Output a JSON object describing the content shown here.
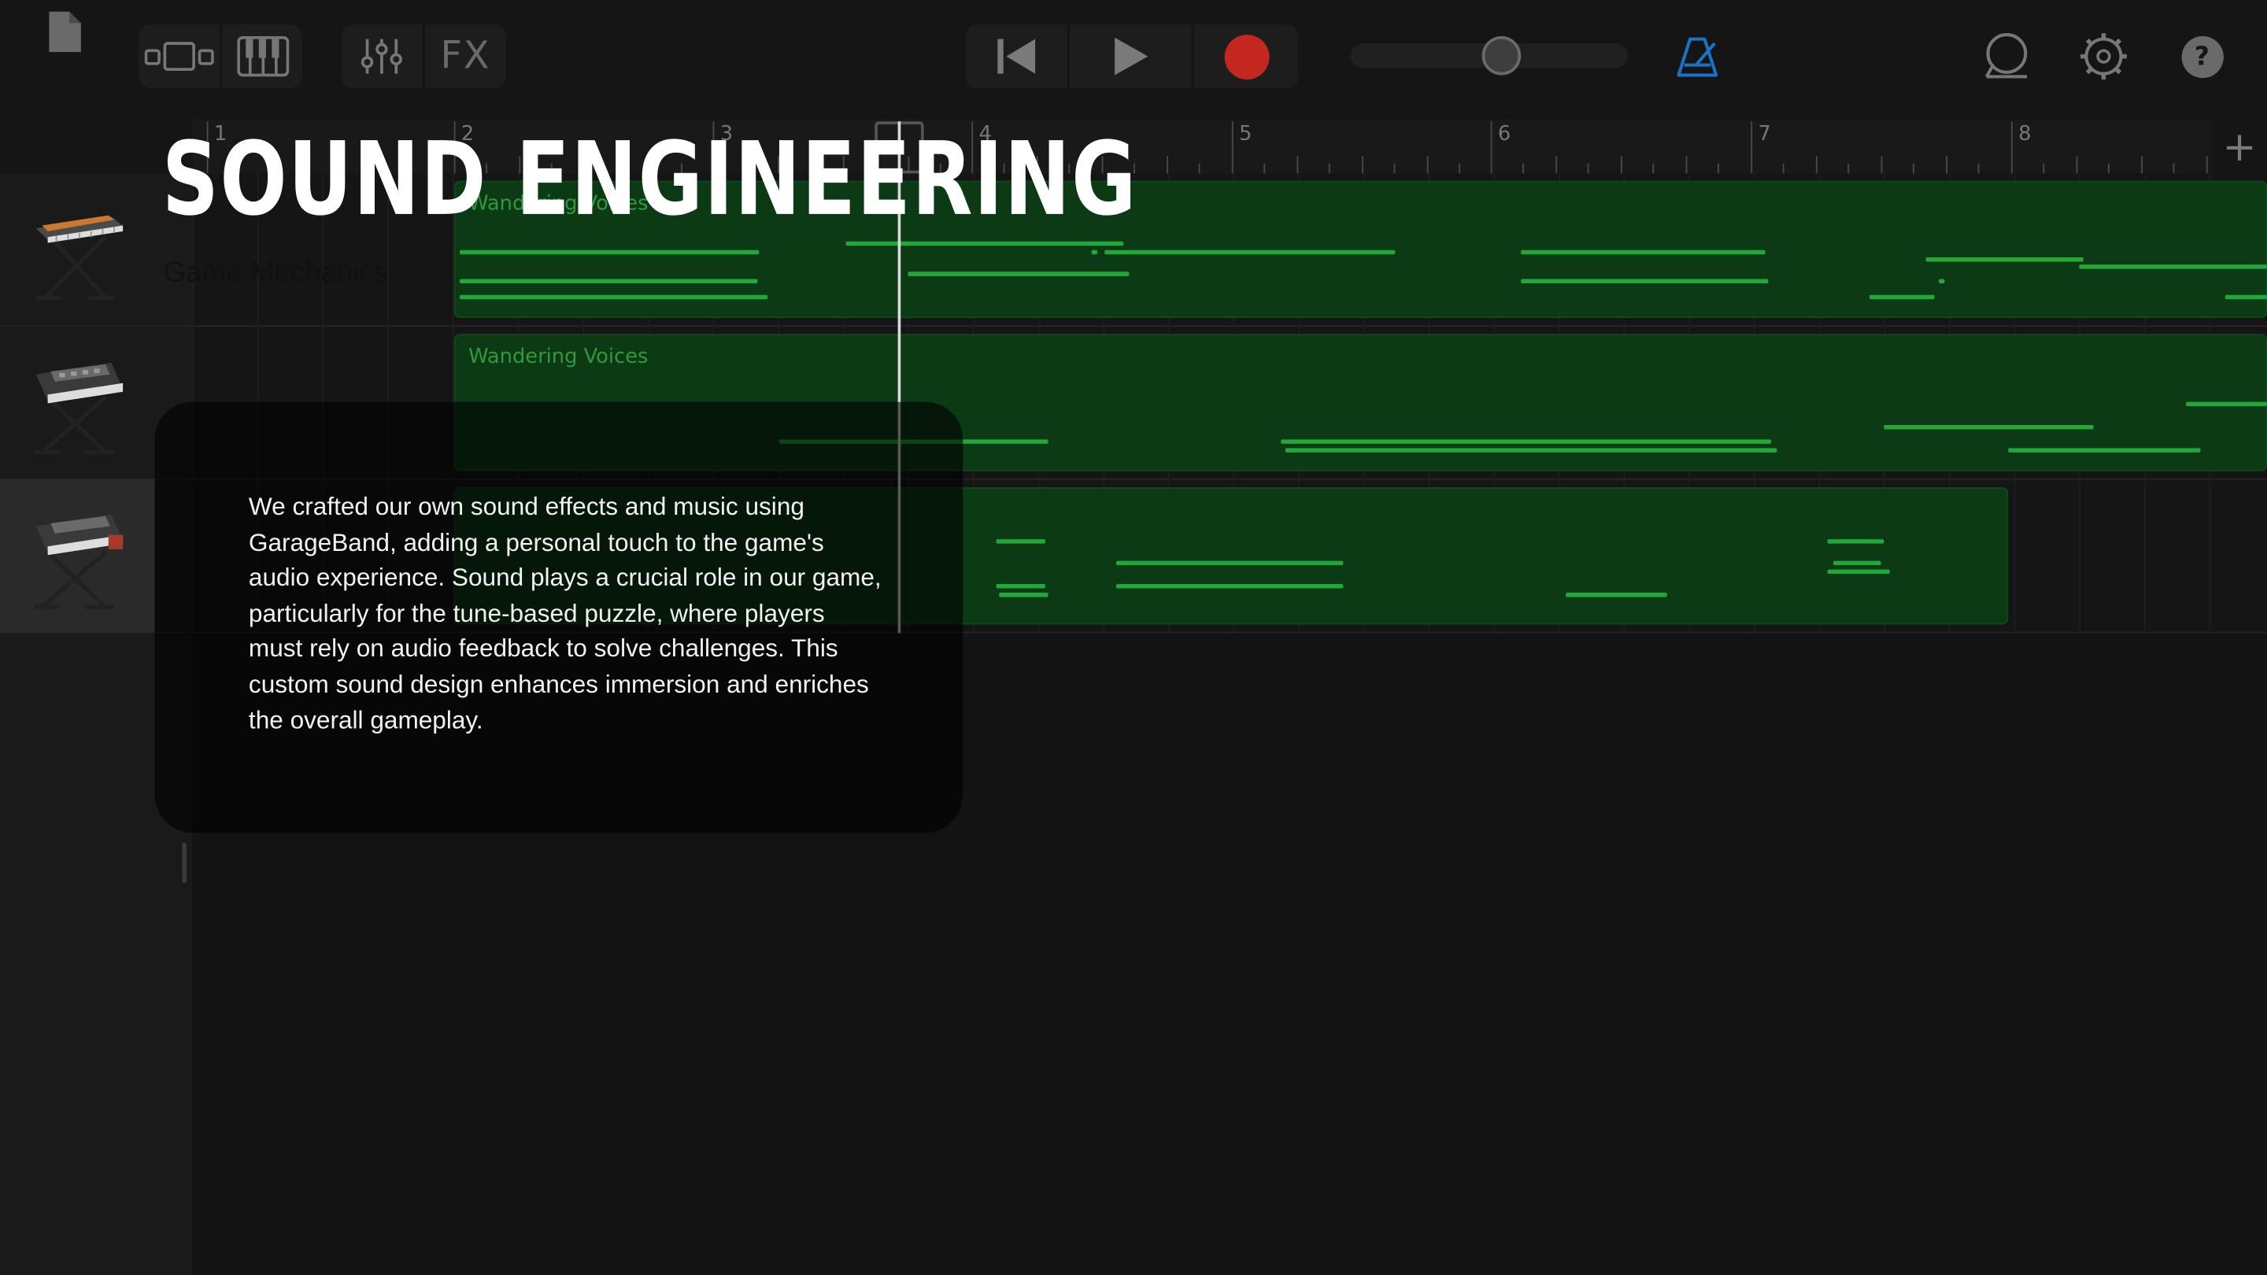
{
  "toolbar": {
    "icons": [
      "document-icon",
      "view-toggle-icon",
      "keyboard-icon",
      "mixer-icon",
      "fx-icon",
      "rewind-icon",
      "play-icon",
      "record-icon",
      "master-volume-slider",
      "metronome-icon",
      "loop-browser-icon",
      "settings-icon",
      "help-icon"
    ],
    "fx_label": "FX",
    "help_label": "?",
    "master_volume": 0.55,
    "colors": {
      "record": "#c4271f",
      "metronome": "#1a73c9"
    }
  },
  "ruler": {
    "numbers": [
      "1",
      "2",
      "3",
      "4",
      "5",
      "6",
      "7",
      "8"
    ],
    "add_label": "+"
  },
  "tracks": [
    {
      "name": "keyboard-track-1",
      "selected": false
    },
    {
      "name": "keyboard-track-2",
      "selected": false
    },
    {
      "name": "keyboard-track-3",
      "selected": true
    }
  ],
  "regions": [
    {
      "title": "Wandering Voices"
    },
    {
      "title": "Wandering Voices"
    },
    {
      "title": ""
    }
  ],
  "overlay": {
    "title": "SOUND ENGINEERING",
    "subtitle": "Game Mechanics",
    "description": "We crafted our own sound effects and music using GarageBand, adding a personal touch to the game's audio experience. Sound plays a crucial role in our game, particularly for the tune-based puzzle, where players must rely on audio feedback to solve challenges. This custom sound design enhances immersion and enriches the overall gameplay."
  }
}
